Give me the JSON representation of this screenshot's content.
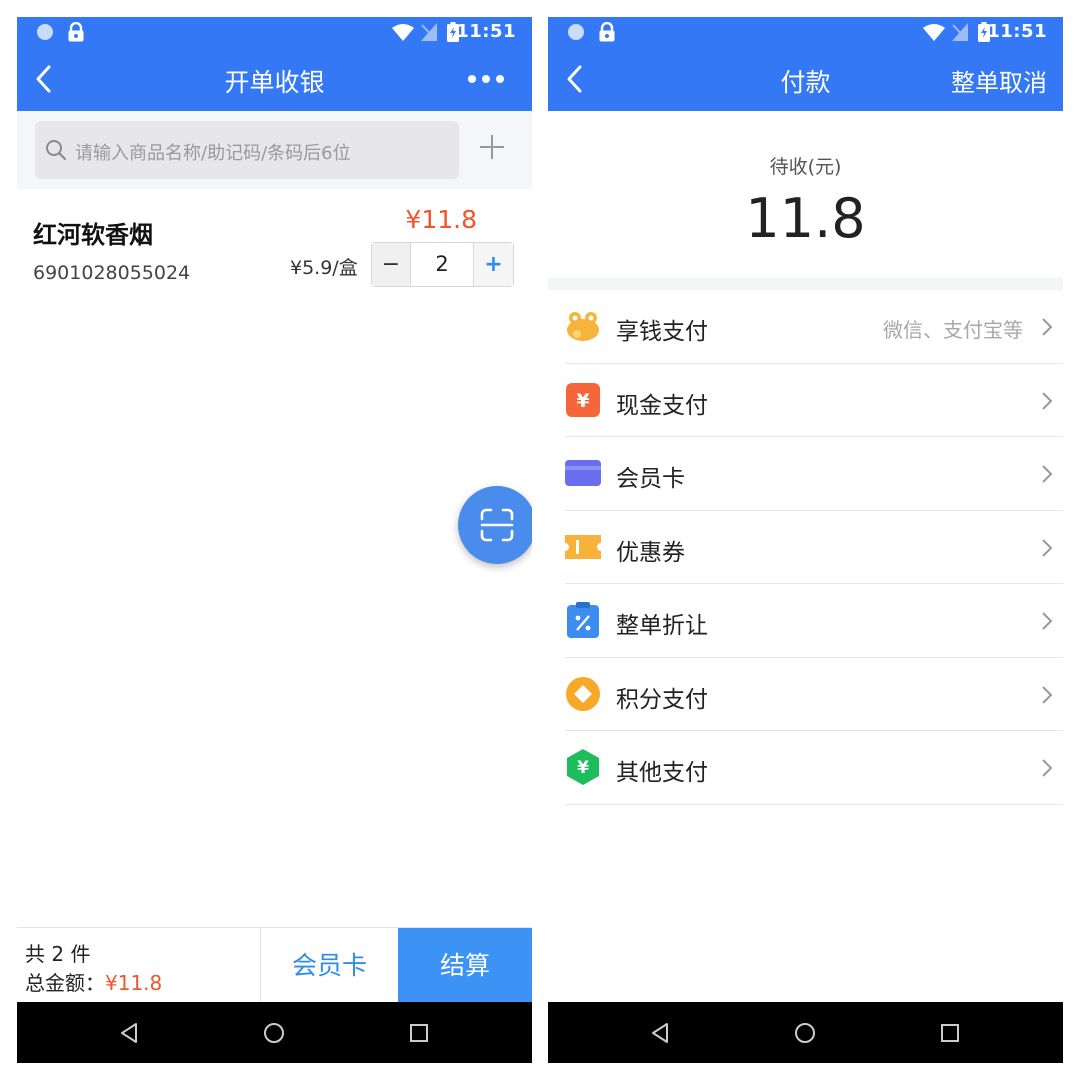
{
  "status_bar": {
    "time": "11:51"
  },
  "left": {
    "nav": {
      "title": "开单收银"
    },
    "search": {
      "placeholder": "请输入商品名称/助记码/条码后6位"
    },
    "item": {
      "name": "红河软香烟",
      "barcode": "6901028055024",
      "line_total": "¥11.8",
      "unit_price": "¥5.9/盒",
      "quantity": "2",
      "minus_label": "−",
      "plus_label": "+"
    },
    "footer": {
      "count_text": "共 2 件",
      "total_label": "总金额：",
      "total_amount": "¥11.8",
      "member_button": "会员卡",
      "checkout_button": "结算"
    }
  },
  "right": {
    "nav": {
      "title": "付款",
      "cancel_label": "整单取消"
    },
    "due_label": "待收(元)",
    "due_amount": "11.8",
    "payment_methods": [
      {
        "label": "享钱支付",
        "hint": "微信、支付宝等",
        "icon": "frog-coin-icon",
        "color": "#f5b43c"
      },
      {
        "label": "现金支付",
        "hint": "",
        "icon": "cash-yen-icon",
        "color": "#f5663a"
      },
      {
        "label": "会员卡",
        "hint": "",
        "icon": "member-card-icon",
        "color": "#6b6df0"
      },
      {
        "label": "优惠券",
        "hint": "",
        "icon": "coupon-icon",
        "color": "#f7b23a"
      },
      {
        "label": "整单折让",
        "hint": "",
        "icon": "discount-clipboard-icon",
        "color": "#3b8df0"
      },
      {
        "label": "积分支付",
        "hint": "",
        "icon": "points-coin-icon",
        "color": "#f7a826"
      },
      {
        "label": "其他支付",
        "hint": "",
        "icon": "other-pay-hexagon-icon",
        "color": "#1dbd5e"
      }
    ]
  },
  "colors": {
    "primary": "#3478f6",
    "price_red": "#f0552b",
    "link_blue": "#2e8bf0"
  }
}
